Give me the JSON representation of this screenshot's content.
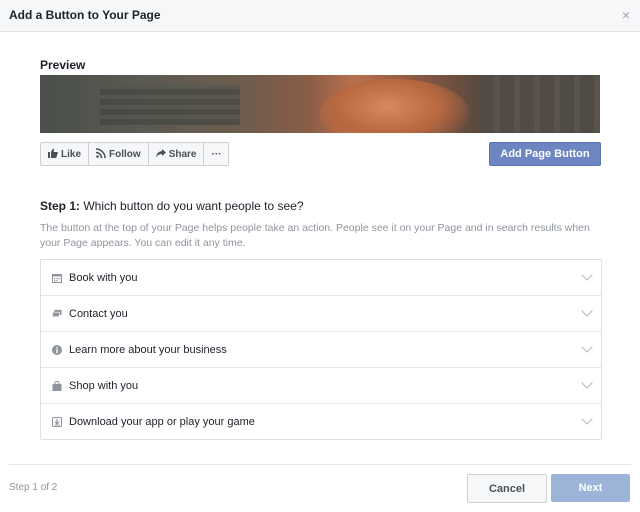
{
  "dialog": {
    "title": "Add a Button to Your Page",
    "close_glyph": "×",
    "preview_label": "Preview",
    "page_buttons": [
      {
        "label": "Like",
        "icon": "thumbs-up-icon"
      },
      {
        "label": "Follow",
        "icon": "rss-icon"
      },
      {
        "label": "Share",
        "icon": "share-arrow-icon"
      },
      {
        "label": "···",
        "icon": "more-icon"
      }
    ],
    "add_button_label": "Add Page Button",
    "step": {
      "number_label": "Step 1:",
      "question": "Which button do you want people to see?",
      "description": "The button at the top of your Page helps people take an action. People see it on your Page and in search results when your Page appears. You can edit it any time."
    },
    "options": [
      {
        "label": "Book with you",
        "icon": "calendar-icon"
      },
      {
        "label": "Contact you",
        "icon": "message-icon"
      },
      {
        "label": "Learn more about your business",
        "icon": "info-icon"
      },
      {
        "label": "Shop with you",
        "icon": "shopping-bag-icon"
      },
      {
        "label": "Download your app or play your game",
        "icon": "download-icon"
      }
    ],
    "footer": {
      "step_count": "Step 1 of 2",
      "cancel_label": "Cancel",
      "next_label": "Next"
    }
  },
  "colors": {
    "accent": "#6d86c1",
    "next_disabled": "#9cb4d8",
    "header_bg": "#f6f7f9"
  }
}
